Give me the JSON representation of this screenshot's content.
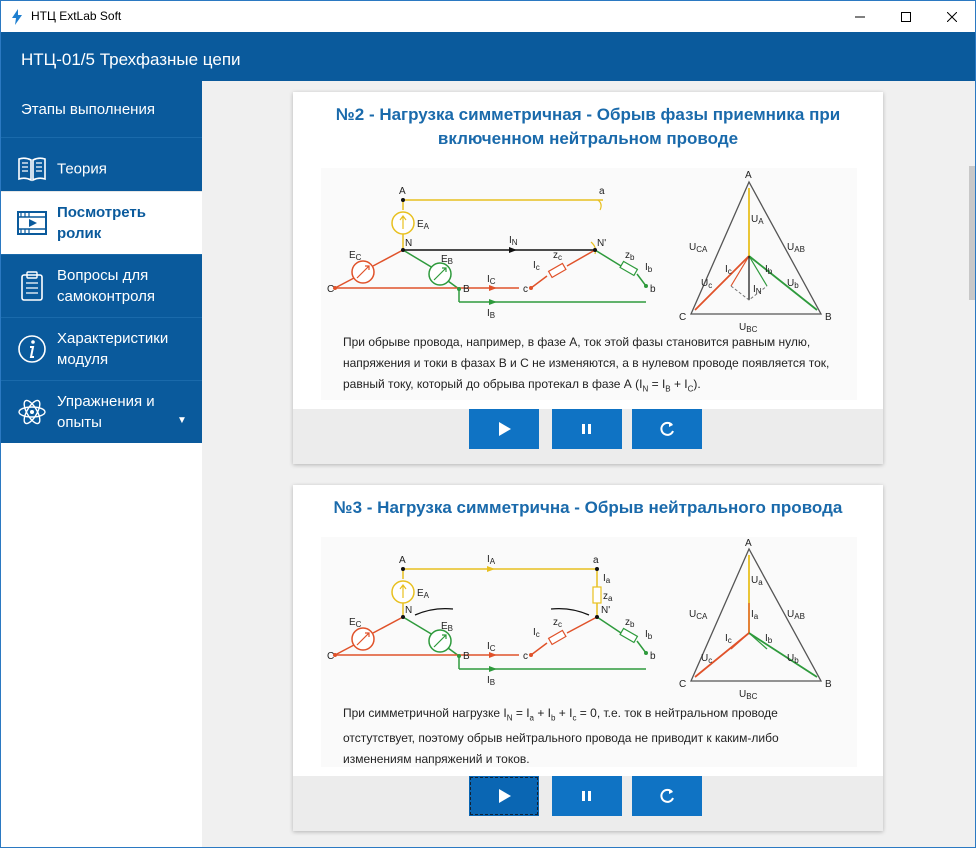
{
  "window": {
    "title": "НТЦ ExtLab Soft"
  },
  "header": {
    "title": "НТЦ-01/5 Трехфазные цепи"
  },
  "sidebar": {
    "heading": "Этапы выполнения",
    "items": [
      {
        "label": "Теория",
        "icon": "book-icon"
      },
      {
        "label": "Посмотреть\nролик",
        "icon": "video-icon",
        "active": true
      },
      {
        "label": "Вопросы для\nсамоконтроля",
        "icon": "clipboard-icon"
      },
      {
        "label": "Характеристики\nмодуля",
        "icon": "info-icon"
      },
      {
        "label": "Упражнения и\nопыты",
        "icon": "atom-icon"
      }
    ]
  },
  "cards": [
    {
      "title": "№2 - Нагрузка симметричная - Обрыв фазы приемника при включенном нейтральном проводе",
      "title_line1": "№2 - Нагрузка симметричная - Обрыв фазы приемника при",
      "title_line2": "включенном нейтральном проводе",
      "desc_line1": "При обрыве провода, например, в фазе А, ток этой фазы становится равным нулю,",
      "desc_line2": "напряжения и токи в фазах В и С не изменяются, а в нулевом проводе появляется ток,",
      "desc_line3": "равный току, который до обрыва протекал в фазе А (I",
      "desc_line3_n": "N",
      "desc_line3_mid": " = I",
      "desc_line3_b": "B",
      "desc_line3_plus": " + I",
      "desc_line3_c": "C",
      "desc_line3_end": ")."
    },
    {
      "title": "№3 - Нагрузка симметрична - Обрыв нейтрального провода",
      "desc_line1_a": "При симметричной нагрузке I",
      "desc_line1_n": "N",
      "desc_line1_b": " = I",
      "desc_line1_sa": "a",
      "desc_line1_c": " + I",
      "desc_line1_sb": "b",
      "desc_line1_d": " + I",
      "desc_line1_sc": "c",
      "desc_line1_e": " = 0, т.е. ток в нейтральном проводе",
      "desc_line2": "отстутствует, поэтому обрыв нейтрального провода не приводит к каким-либо",
      "desc_line3": "изменениям напряжений и токов."
    }
  ],
  "diagram_labels": {
    "A": "A",
    "a": "a",
    "N": "N",
    "Nprime": "N'",
    "B": "B",
    "b": "b",
    "C": "C",
    "c": "c",
    "EA": "E",
    "EA_sub": "A",
    "EB": "E",
    "EB_sub": "B",
    "EC": "E",
    "EC_sub": "C",
    "IN": "I",
    "IN_sub": "N",
    "IA": "I",
    "IA_sub": "A",
    "IB": "I",
    "IB_sub": "B",
    "IC": "I",
    "IC_sub": "C",
    "Ia": "I",
    "Ia_sub": "a",
    "Ib": "I",
    "Ib_sub": "b",
    "Ic": "I",
    "Ic_sub": "c",
    "za": "z",
    "za_sub": "a",
    "zb": "z",
    "zb_sub": "b",
    "zc": "z",
    "zc_sub": "c",
    "UCA": "U",
    "UCA_sub": "CA",
    "UAB": "U",
    "UAB_sub": "AB",
    "UBC": "U",
    "UBC_sub": "BC",
    "UA": "U",
    "UA_sub": "A",
    "Ua": "U",
    "Ua_sub": "a",
    "Ub": "U",
    "Ub_sub": "b",
    "Uc": "U",
    "Uc_sub": "c"
  },
  "controls": {
    "play": "play-icon",
    "pause": "pause-icon",
    "restart": "restart-icon"
  },
  "colors": {
    "header": "#0a5a9c",
    "button": "#0f73c4",
    "title": "#1a6aab",
    "phaseA": "#e8c020",
    "phaseB": "#2e9a3c",
    "phaseC": "#e0522a"
  }
}
